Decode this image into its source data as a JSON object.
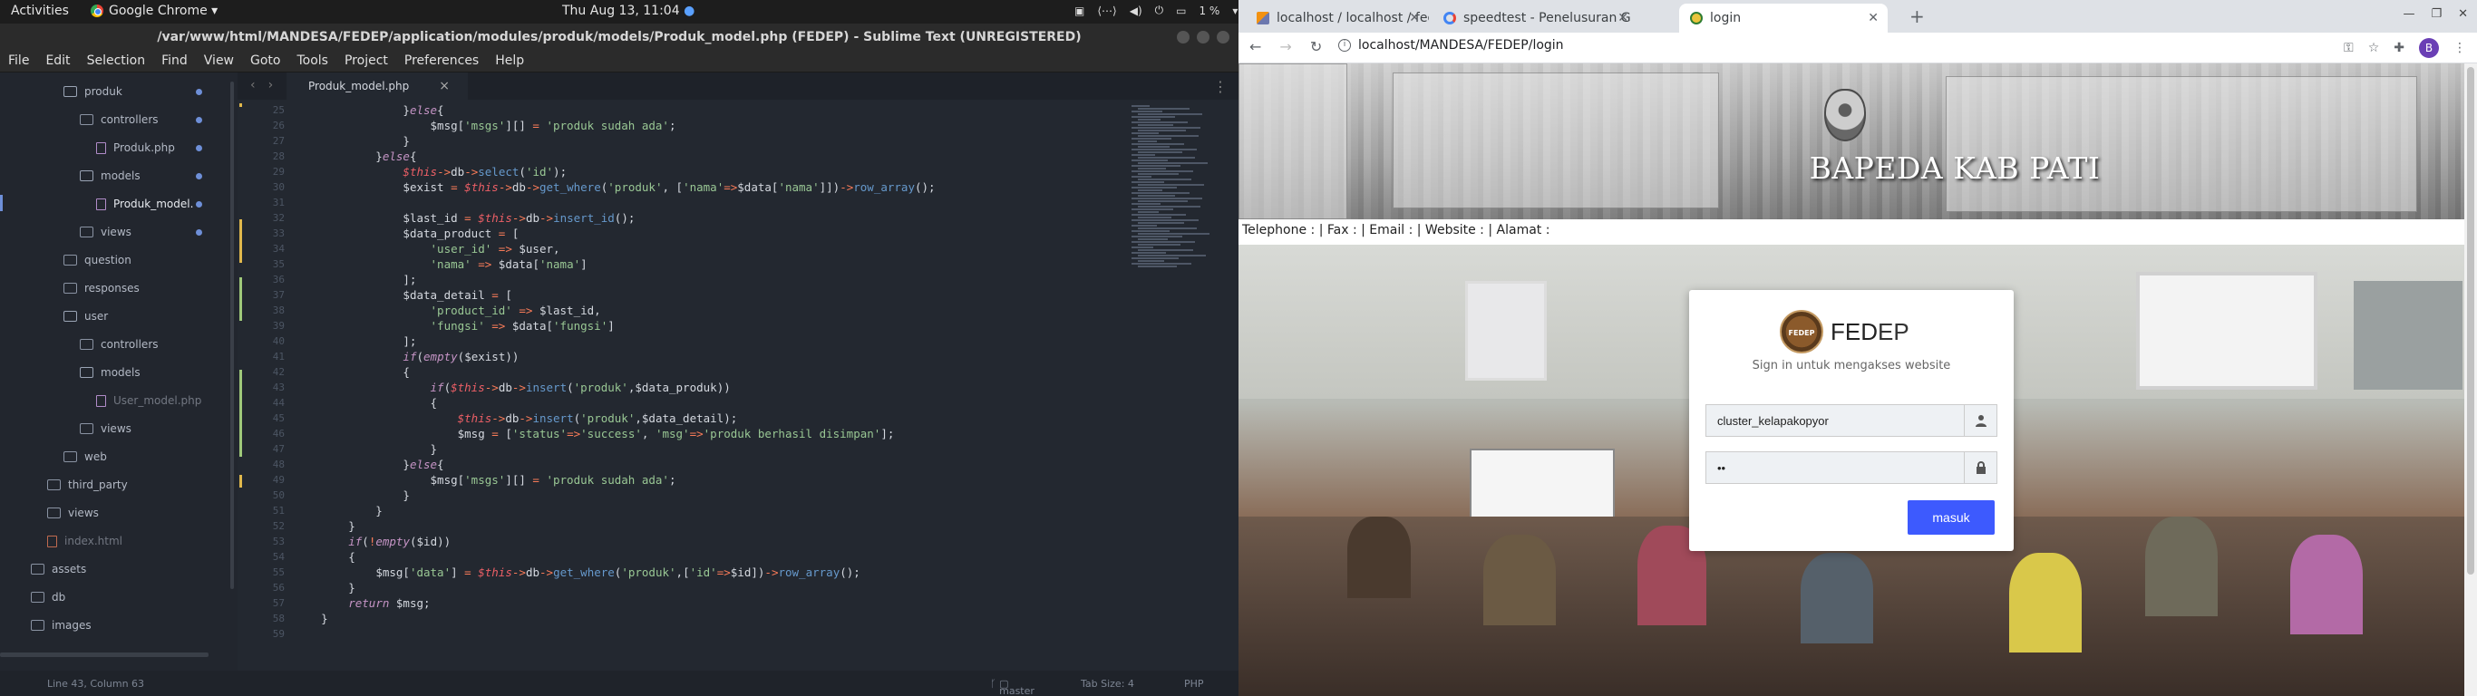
{
  "system": {
    "activities": "Activities",
    "app_name": "Google Chrome ▾",
    "clock": "Thu Aug 13, 11:04",
    "battery": "1 %"
  },
  "sublime": {
    "title": "/var/www/html/MANDESA/FEDEP/application/modules/produk/models/Produk_model.php (FEDEP) - Sublime Text (UNREGISTERED)",
    "menu": [
      "File",
      "Edit",
      "Selection",
      "Find",
      "View",
      "Goto",
      "Tools",
      "Project",
      "Preferences",
      "Help"
    ],
    "tab": "Produk_model.php",
    "sidebar": [
      {
        "label": "produk",
        "kind": "folder-open",
        "indent": 70,
        "dot": true
      },
      {
        "label": "controllers",
        "kind": "folder",
        "indent": 88,
        "dot": true
      },
      {
        "label": "Produk.php",
        "kind": "php",
        "indent": 106,
        "dot": true
      },
      {
        "label": "models",
        "kind": "folder-open",
        "indent": 88,
        "dot": true
      },
      {
        "label": "Produk_model.",
        "kind": "php",
        "indent": 106,
        "dot": true
      },
      {
        "label": "views",
        "kind": "folder",
        "indent": 88,
        "dot": true
      },
      {
        "label": "question",
        "kind": "folder",
        "indent": 70,
        "dot": false
      },
      {
        "label": "responses",
        "kind": "folder",
        "indent": 70,
        "dot": false
      },
      {
        "label": "user",
        "kind": "folder-open",
        "indent": 70,
        "dot": false
      },
      {
        "label": "controllers",
        "kind": "folder",
        "indent": 88,
        "dot": false
      },
      {
        "label": "models",
        "kind": "folder-open",
        "indent": 88,
        "dot": false
      },
      {
        "label": "User_model.php",
        "kind": "php",
        "indent": 106,
        "dot": false
      },
      {
        "label": "views",
        "kind": "folder",
        "indent": 88,
        "dot": false
      },
      {
        "label": "web",
        "kind": "folder",
        "indent": 70,
        "dot": false
      },
      {
        "label": "third_party",
        "kind": "folder",
        "indent": 52,
        "dot": false
      },
      {
        "label": "views",
        "kind": "folder",
        "indent": 52,
        "dot": false
      },
      {
        "label": "index.html",
        "kind": "html",
        "indent": 52,
        "dot": false
      },
      {
        "label": "assets",
        "kind": "folder",
        "indent": 34,
        "dot": false
      },
      {
        "label": "db",
        "kind": "folder",
        "indent": 34,
        "dot": false
      },
      {
        "label": "images",
        "kind": "folder",
        "indent": 34,
        "dot": false
      }
    ],
    "line_start": 25,
    "code_lines": [
      "                }else{",
      "                    $msg['msgs'][] = 'produk sudah ada';",
      "                }",
      "            }else{",
      "                $this->db->select('id');",
      "                $exist = $this->db->get_where('produk', ['nama'=>$data['nama']])->row_array();",
      "",
      "                $last_id = $this->db->insert_id();",
      "                $data_product = [",
      "                    'user_id' => $user,",
      "                    'nama' => $data['nama']",
      "                ];",
      "                $data_detail = [",
      "                    'product_id' => $last_id,",
      "                    'fungsi' => $data['fungsi']",
      "                ];",
      "                if(empty($exist))",
      "                {",
      "                    if($this->db->insert('produk',$data_produk))",
      "                    {",
      "                        $this->db->insert('produk',$data_detail);",
      "                        $msg = ['status'=>'success', 'msg'=>'produk berhasil disimpan'];",
      "                    }",
      "                }else{",
      "                    $msg['msgs'][] = 'produk sudah ada';",
      "                }",
      "            }",
      "        }",
      "        if(!empty($id))",
      "        {",
      "            $msg['data'] = $this->db->get_where('produk',['id'=>$id])->row_array();",
      "        }",
      "        return $msg;",
      "    }",
      ""
    ],
    "status_left": "Line 43, Column 63",
    "status_branch": "master",
    "status_tab": "Tab Size: 4",
    "status_syntax": "PHP"
  },
  "chrome": {
    "tabs": [
      {
        "title": "localhost / localhost / fed",
        "favicon": "pma"
      },
      {
        "title": "speedtest - Penelusuran G",
        "favicon": "google"
      },
      {
        "title": "login",
        "favicon": "seal"
      }
    ],
    "url": "localhost/MANDESA/FEDEP/login",
    "avatar": "B"
  },
  "page": {
    "banner_title": "BAPEDA KAB PATI",
    "contact": "Telephone : | Fax : | Email : | Website : | Alamat :",
    "logo_text": "FEDEP",
    "brand_a": "FED",
    "brand_b": "EP",
    "subtitle": "Sign in untuk mengakses website",
    "username_value": "cluster_kelapakopyor",
    "password_value": "••",
    "submit_label": "masuk"
  }
}
